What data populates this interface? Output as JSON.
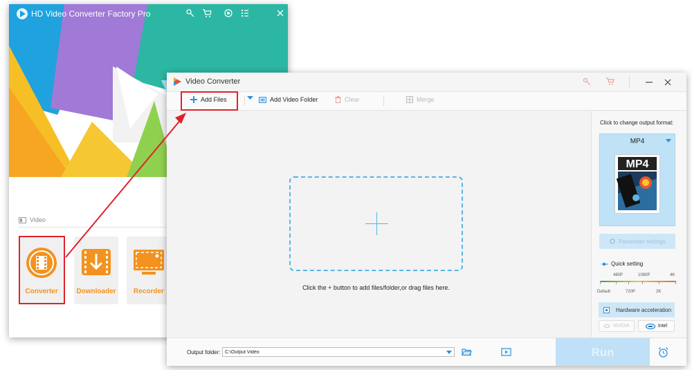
{
  "main_window": {
    "title": "HD Video Converter Factory Pro",
    "section_label": "Video",
    "tiles": [
      {
        "label": "Converter",
        "icon": "film-icon"
      },
      {
        "label": "Downloader",
        "icon": "download-icon"
      },
      {
        "label": "Recorder",
        "icon": "screen-record-icon"
      }
    ],
    "titlebar_icons": [
      "key-icon",
      "cart-icon",
      "target-icon",
      "list-icon",
      "close-icon"
    ]
  },
  "converter_window": {
    "title": "Video Converter",
    "toolbar": {
      "add_files": "Add Files",
      "add_video_folder": "Add Video Folder",
      "clear": "Clear",
      "merge": "Merge"
    },
    "drop_hint": "Click the + button to add files/folder,or drag files here.",
    "side_panel": {
      "format_caption": "Click to change output format:",
      "format_name": "MP4",
      "format_thumb_label": "MP4",
      "parameter_settings": "Parameter settings",
      "quick_setting": "Quick setting",
      "quality_ticks_top": [
        "480P",
        "1080P",
        "4K"
      ],
      "quality_ticks_bottom": [
        "Default",
        "720P",
        "2K"
      ],
      "hardware_acceleration": "Hardware acceleration",
      "gpu_nvidia": "NVIDIA",
      "gpu_intel": "Intel"
    },
    "bottom_bar": {
      "output_label": "Output folder:",
      "output_path": "C:\\Output Video",
      "run_label": "Run"
    }
  },
  "colors": {
    "accent_blue": "#2a8fdc",
    "highlight_red": "#e0212b",
    "tile_orange": "#f3921e"
  }
}
